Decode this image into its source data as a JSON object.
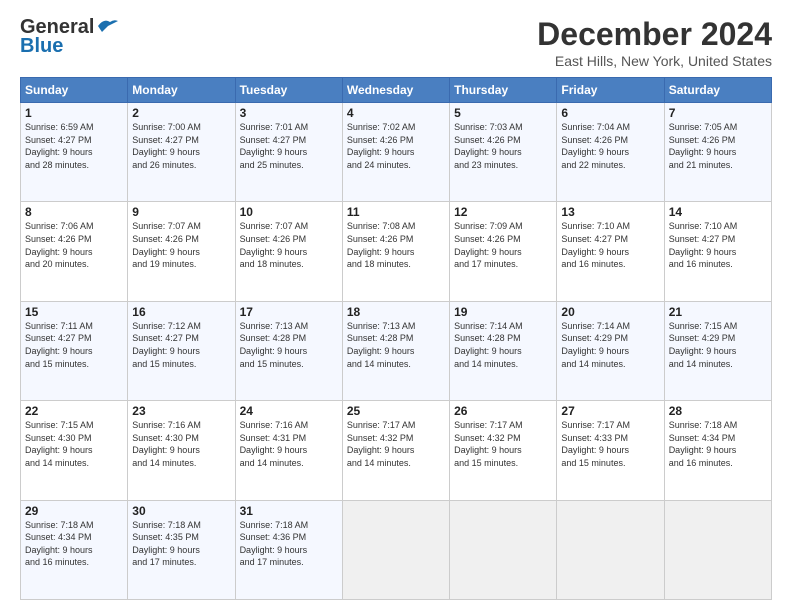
{
  "header": {
    "logo_line1": "General",
    "logo_line2": "Blue",
    "month": "December 2024",
    "location": "East Hills, New York, United States"
  },
  "weekdays": [
    "Sunday",
    "Monday",
    "Tuesday",
    "Wednesday",
    "Thursday",
    "Friday",
    "Saturday"
  ],
  "weeks": [
    [
      {
        "day": "1",
        "info": "Sunrise: 6:59 AM\nSunset: 4:27 PM\nDaylight: 9 hours\nand 28 minutes."
      },
      {
        "day": "2",
        "info": "Sunrise: 7:00 AM\nSunset: 4:27 PM\nDaylight: 9 hours\nand 26 minutes."
      },
      {
        "day": "3",
        "info": "Sunrise: 7:01 AM\nSunset: 4:27 PM\nDaylight: 9 hours\nand 25 minutes."
      },
      {
        "day": "4",
        "info": "Sunrise: 7:02 AM\nSunset: 4:26 PM\nDaylight: 9 hours\nand 24 minutes."
      },
      {
        "day": "5",
        "info": "Sunrise: 7:03 AM\nSunset: 4:26 PM\nDaylight: 9 hours\nand 23 minutes."
      },
      {
        "day": "6",
        "info": "Sunrise: 7:04 AM\nSunset: 4:26 PM\nDaylight: 9 hours\nand 22 minutes."
      },
      {
        "day": "7",
        "info": "Sunrise: 7:05 AM\nSunset: 4:26 PM\nDaylight: 9 hours\nand 21 minutes."
      }
    ],
    [
      {
        "day": "8",
        "info": "Sunrise: 7:06 AM\nSunset: 4:26 PM\nDaylight: 9 hours\nand 20 minutes."
      },
      {
        "day": "9",
        "info": "Sunrise: 7:07 AM\nSunset: 4:26 PM\nDaylight: 9 hours\nand 19 minutes."
      },
      {
        "day": "10",
        "info": "Sunrise: 7:07 AM\nSunset: 4:26 PM\nDaylight: 9 hours\nand 18 minutes."
      },
      {
        "day": "11",
        "info": "Sunrise: 7:08 AM\nSunset: 4:26 PM\nDaylight: 9 hours\nand 18 minutes."
      },
      {
        "day": "12",
        "info": "Sunrise: 7:09 AM\nSunset: 4:26 PM\nDaylight: 9 hours\nand 17 minutes."
      },
      {
        "day": "13",
        "info": "Sunrise: 7:10 AM\nSunset: 4:27 PM\nDaylight: 9 hours\nand 16 minutes."
      },
      {
        "day": "14",
        "info": "Sunrise: 7:10 AM\nSunset: 4:27 PM\nDaylight: 9 hours\nand 16 minutes."
      }
    ],
    [
      {
        "day": "15",
        "info": "Sunrise: 7:11 AM\nSunset: 4:27 PM\nDaylight: 9 hours\nand 15 minutes."
      },
      {
        "day": "16",
        "info": "Sunrise: 7:12 AM\nSunset: 4:27 PM\nDaylight: 9 hours\nand 15 minutes."
      },
      {
        "day": "17",
        "info": "Sunrise: 7:13 AM\nSunset: 4:28 PM\nDaylight: 9 hours\nand 15 minutes."
      },
      {
        "day": "18",
        "info": "Sunrise: 7:13 AM\nSunset: 4:28 PM\nDaylight: 9 hours\nand 14 minutes."
      },
      {
        "day": "19",
        "info": "Sunrise: 7:14 AM\nSunset: 4:28 PM\nDaylight: 9 hours\nand 14 minutes."
      },
      {
        "day": "20",
        "info": "Sunrise: 7:14 AM\nSunset: 4:29 PM\nDaylight: 9 hours\nand 14 minutes."
      },
      {
        "day": "21",
        "info": "Sunrise: 7:15 AM\nSunset: 4:29 PM\nDaylight: 9 hours\nand 14 minutes."
      }
    ],
    [
      {
        "day": "22",
        "info": "Sunrise: 7:15 AM\nSunset: 4:30 PM\nDaylight: 9 hours\nand 14 minutes."
      },
      {
        "day": "23",
        "info": "Sunrise: 7:16 AM\nSunset: 4:30 PM\nDaylight: 9 hours\nand 14 minutes."
      },
      {
        "day": "24",
        "info": "Sunrise: 7:16 AM\nSunset: 4:31 PM\nDaylight: 9 hours\nand 14 minutes."
      },
      {
        "day": "25",
        "info": "Sunrise: 7:17 AM\nSunset: 4:32 PM\nDaylight: 9 hours\nand 14 minutes."
      },
      {
        "day": "26",
        "info": "Sunrise: 7:17 AM\nSunset: 4:32 PM\nDaylight: 9 hours\nand 15 minutes."
      },
      {
        "day": "27",
        "info": "Sunrise: 7:17 AM\nSunset: 4:33 PM\nDaylight: 9 hours\nand 15 minutes."
      },
      {
        "day": "28",
        "info": "Sunrise: 7:18 AM\nSunset: 4:34 PM\nDaylight: 9 hours\nand 16 minutes."
      }
    ],
    [
      {
        "day": "29",
        "info": "Sunrise: 7:18 AM\nSunset: 4:34 PM\nDaylight: 9 hours\nand 16 minutes."
      },
      {
        "day": "30",
        "info": "Sunrise: 7:18 AM\nSunset: 4:35 PM\nDaylight: 9 hours\nand 17 minutes."
      },
      {
        "day": "31",
        "info": "Sunrise: 7:18 AM\nSunset: 4:36 PM\nDaylight: 9 hours\nand 17 minutes."
      },
      null,
      null,
      null,
      null
    ]
  ]
}
